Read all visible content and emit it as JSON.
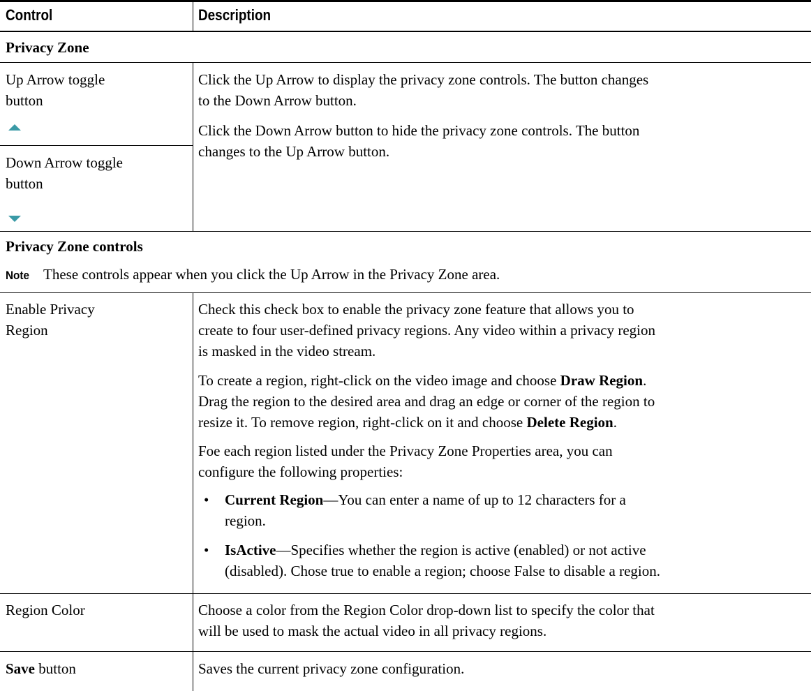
{
  "header": {
    "control": "Control",
    "description": "Description"
  },
  "sections": {
    "privacy_zone": "Privacy Zone",
    "privacy_zone_controls": "Privacy Zone controls"
  },
  "note": {
    "label": "Note",
    "text": "These controls appear when you click the Up Arrow in the Privacy Zone area."
  },
  "rows": {
    "up_arrow": {
      "control_line1": "Up Arrow toggle",
      "control_line2": "button",
      "icon": "up-triangle-icon"
    },
    "down_arrow": {
      "control_line1": "Down Arrow toggle",
      "control_line2": "button",
      "icon": "down-triangle-icon"
    },
    "arrow_description": {
      "p1_line1": "Click the Up Arrow to display the privacy zone controls. The button changes",
      "p1_line2": "to the Down Arrow button.",
      "p2_line1": "Click the Down Arrow button to hide the privacy zone controls. The button",
      "p2_line2": "changes to the Up Arrow button."
    },
    "enable_privacy": {
      "control_line1": "Enable Privacy",
      "control_line2": "Region",
      "p1_line1": "Check this check box to enable the privacy zone feature that allows you to",
      "p1_line2": "create to four user-defined privacy regions. Any video within a privacy region",
      "p1_line3": "is masked in the video stream.",
      "p2_line1_a": "To create a region, right-click on the video image and choose ",
      "p2_line1_b": "Draw Region",
      "p2_line1_c": ".",
      "p2_line2": "Drag the region to the desired area and drag an edge or corner of the region to",
      "p2_line3_a": "resize it. To remove region, right-click on it and choose ",
      "p2_line3_b": "Delete Region",
      "p2_line3_c": ".",
      "p3_line1": "Foe each region listed under the Privacy Zone Properties area, you can",
      "p3_line2": "configure the following properties:",
      "bullet_symbol": "•",
      "bullet1_term": "Current Region",
      "bullet1_line1": "—You can enter a name of up to 12 characters for a",
      "bullet1_line2": "region.",
      "bullet2_term": "IsActive",
      "bullet2_line1": "—Specifies whether the region is active (enabled) or not active",
      "bullet2_line2": "(disabled). Chose true to enable a region; choose False to disable a region."
    },
    "region_color": {
      "control": "Region Color",
      "desc_line1": "Choose a color from the Region Color drop-down list to specify the color that",
      "desc_line2": "will be used to mask the actual video in all privacy regions."
    },
    "save": {
      "control_bold": "Save",
      "control_rest": " button",
      "desc": "Saves the current privacy zone configuration."
    }
  }
}
